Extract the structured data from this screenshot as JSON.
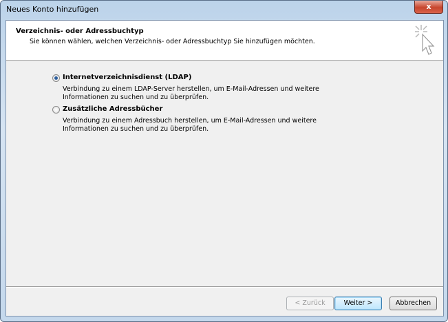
{
  "window": {
    "title": "Neues Konto hinzufügen",
    "close_label": "x"
  },
  "header": {
    "title": "Verzeichnis- oder Adressbuchtyp",
    "subtitle": "Sie können wählen, welchen Verzeichnis- oder Adressbuchtyp Sie hinzufügen möchten.",
    "icon": "wand-cursor-icon"
  },
  "options": [
    {
      "label": "Internetverzeichnisdienst (LDAP)",
      "desc1": "Verbindung zu einem LDAP-Server herstellen, um E-Mail-Adressen und weitere",
      "desc2": "Informationen zu suchen und zu überprüfen.",
      "selected": true
    },
    {
      "label": "Zusätzliche Adressbücher",
      "desc1": "Verbindung zu einem Adressbuch herstellen, um E-Mail-Adressen und weitere",
      "desc2": "Informationen zu suchen und zu überprüfen.",
      "selected": false
    }
  ],
  "buttons": {
    "back": "< Zurück",
    "next": "Weiter >",
    "cancel": "Abbrechen"
  }
}
